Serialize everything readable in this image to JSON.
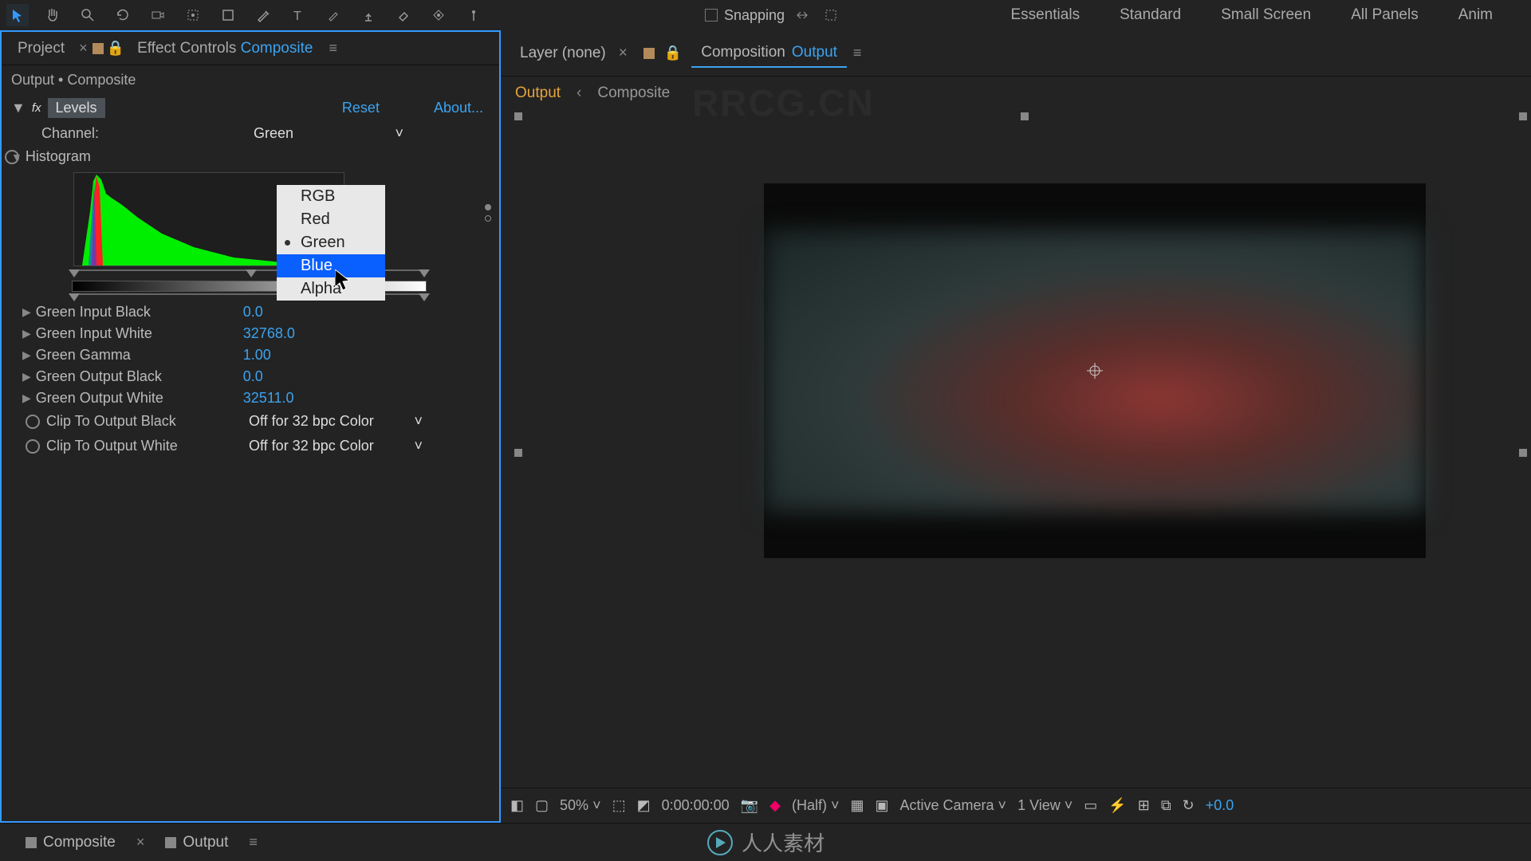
{
  "toolbar": {
    "snapping_label": "Snapping"
  },
  "workspaces": [
    "Essentials",
    "Standard",
    "Small Screen",
    "All Panels",
    "Anim"
  ],
  "leftPanel": {
    "tab_project": "Project",
    "tab_effect_prefix": "Effect Controls ",
    "tab_effect_comp": "Composite",
    "breadcrumb": "Output • Composite",
    "fx_name": "Levels",
    "reset": "Reset",
    "about": "About...",
    "channel_label": "Channel:",
    "channel_value": "Green",
    "histogram_label": "Histogram",
    "channel_options": [
      "RGB",
      "Red",
      "Green",
      "Blue",
      "Alpha"
    ],
    "props": [
      {
        "label": "Green Input Black",
        "value": "0.0"
      },
      {
        "label": "Green Input White",
        "value": "32768.0"
      },
      {
        "label": "Green Gamma",
        "value": "1.00"
      },
      {
        "label": "Green Output Black",
        "value": "0.0"
      },
      {
        "label": "Green Output White",
        "value": "32511.0"
      }
    ],
    "clip_black_label": "Clip To Output Black",
    "clip_white_label": "Clip To Output White",
    "clip_value": "Off for 32 bpc Color"
  },
  "viewer": {
    "tab_layer": "Layer (none)",
    "tab_comp_prefix": "Composition ",
    "tab_comp_name": "Output",
    "bc_output": "Output",
    "bc_composite": "Composite",
    "zoom": "50%",
    "timecode": "0:00:00:00",
    "res": "(Half)",
    "camera": "Active Camera",
    "views": "1 View",
    "exposure": "+0.0"
  },
  "bottom": {
    "tab1": "Composite",
    "tab2": "Output"
  },
  "watermark_center": "RRCG.CN",
  "watermark_cn": "人人素材"
}
